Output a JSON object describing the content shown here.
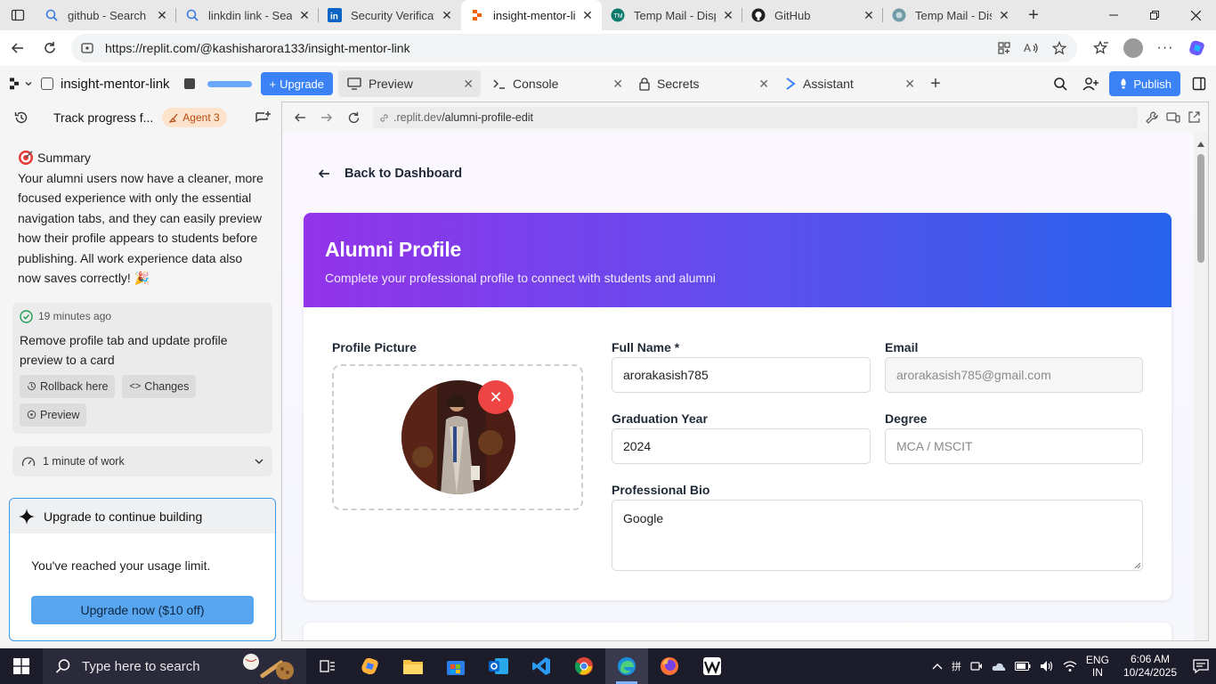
{
  "browser": {
    "tabs": [
      {
        "title": "github - Search",
        "icon": "search-icon",
        "active": false
      },
      {
        "title": "linkdin link - Search",
        "icon": "search-icon",
        "active": false
      },
      {
        "title": "Security Verification",
        "icon": "linkedin-icon",
        "active": false
      },
      {
        "title": "insight-mentor-link",
        "icon": "replit-icon",
        "active": true
      },
      {
        "title": "Temp Mail - Disposable",
        "icon": "tempmail-icon",
        "active": false
      },
      {
        "title": "GitHub",
        "icon": "github-icon",
        "active": false
      },
      {
        "title": "Temp Mail - Disposable",
        "icon": "tempmail-icon",
        "active": false
      }
    ],
    "url": "https://replit.com/@kashisharora133/insight-mentor-link"
  },
  "replit": {
    "project_name": "insight-mentor-link",
    "upgrade_label": "Upgrade",
    "tabs": [
      {
        "label": "Preview",
        "icon": "monitor-icon",
        "active": true
      },
      {
        "label": "Console",
        "icon": "terminal-icon",
        "active": false
      },
      {
        "label": "Secrets",
        "icon": "lock-icon",
        "active": false
      },
      {
        "label": "Assistant",
        "icon": "assistant-icon",
        "active": false
      }
    ],
    "publish_label": "Publish"
  },
  "agent_panel": {
    "thread_title": "Track progress f...",
    "agent_badge": "Agent 3",
    "summary_title": "Summary",
    "summary_text": "Your alumni users now have a cleaner, more focused experience with only the essential navigation tabs, and they can easily preview how their profile appears to students before publishing. All work experience data also now saves correctly! 🎉",
    "checkpoint": {
      "time": "19 minutes ago",
      "message": "Remove profile tab and update profile preview to a card",
      "rollback_label": "Rollback here",
      "changes_label": "Changes",
      "preview_label": "Preview"
    },
    "work_label": "1 minute of work",
    "upgrade_card": {
      "title": "Upgrade to continue building",
      "text": "You've reached your usage limit.",
      "button": "Upgrade now ($10 off)"
    }
  },
  "preview": {
    "url_prefix": ".replit.dev",
    "url_path": "/alumni-profile-edit",
    "back_label": "Back to Dashboard",
    "hero_title": "Alumni Profile",
    "hero_subtitle": "Complete your professional profile to connect with students and alumni",
    "profile_picture_label": "Profile Picture",
    "fields": {
      "full_name_label": "Full Name *",
      "full_name_value": "arorakasish785",
      "email_label": "Email",
      "email_value": "arorakasish785@gmail.com",
      "graduation_year_label": "Graduation Year",
      "graduation_year_value": "2024",
      "degree_label": "Degree",
      "degree_placeholder": "MCA / MSCIT",
      "bio_label": "Professional Bio",
      "bio_value": "Google"
    }
  },
  "taskbar": {
    "search_placeholder": "Type here to search",
    "apps": [
      "task-view",
      "copilot",
      "file-explorer",
      "store",
      "outlook",
      "vscode",
      "chrome",
      "edge",
      "firefox",
      "wps"
    ],
    "language": "ENG",
    "region": "IN",
    "time": "6:06 AM",
    "date": "10/24/2025"
  }
}
